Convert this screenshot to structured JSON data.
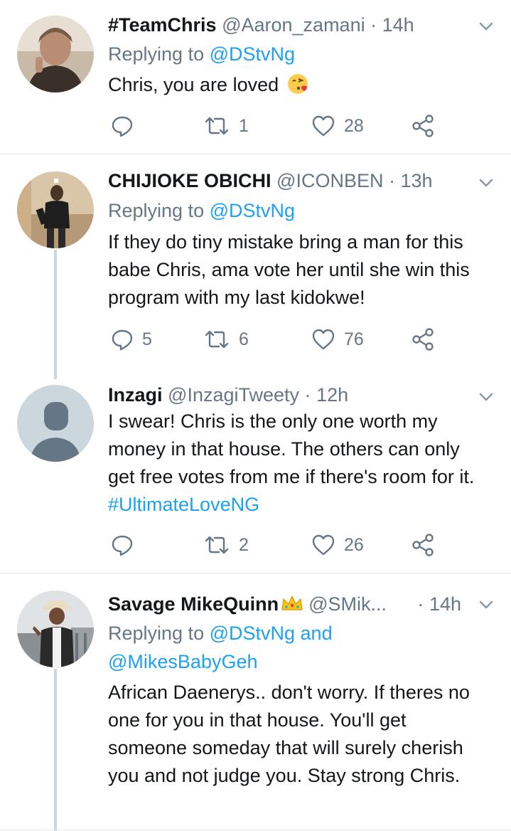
{
  "tweets": [
    {
      "name": "#TeamChris",
      "handle": "@Aaron_zamani",
      "dot": "·",
      "time": "14h",
      "replying_prefix": "Replying to ",
      "replying_to": "@DStvNg",
      "text": "Chris,  you are loved",
      "emoji": "kissing-face-emoji",
      "replies": "",
      "retweets": "1",
      "likes": "28"
    },
    {
      "name": "CHIJIOKE OBICHI",
      "handle": "@ICONBEN",
      "dot": "·",
      "time": "13h",
      "replying_prefix": "Replying to ",
      "replying_to": "@DStvNg",
      "text": "If they do tiny mistake bring a man for this babe Chris, ama vote her until she win this program with my last kidokwe!",
      "replies": "5",
      "retweets": "6",
      "likes": "76"
    },
    {
      "name": "Inzagi",
      "handle": "@InzagiTweety",
      "dot": "·",
      "time": "12h",
      "text": "I swear! Chris is the only one worth my money in that house. The others can only get free votes from me if there's room for it. ",
      "hashtag": "#UltimateLoveNG",
      "replies": "",
      "retweets": "2",
      "likes": "26"
    },
    {
      "name": "Savage MikeQuinn",
      "name_emoji": "crown-emoji",
      "handle": "@SMik...",
      "dot": "·",
      "time": "14h",
      "replying_prefix": "Replying to ",
      "replying_to": "@DStvNg",
      "replying_and": " and",
      "replying_to_2": "@MikesBabyGeh",
      "text": "African Daenerys.. don't worry. If theres no one for you in that house. You'll get someone someday that will surely cherish you and not judge you. Stay strong Chris."
    }
  ],
  "icons": {
    "reply": "reply-icon",
    "retweet": "retweet-icon",
    "like": "heart-icon",
    "share": "share-icon",
    "more": "chevron-down-icon"
  },
  "colors": {
    "link": "#1da1f2",
    "secondary_text": "#657786",
    "divider": "#e1e8ed",
    "thread_line": "#ccd6dd"
  }
}
